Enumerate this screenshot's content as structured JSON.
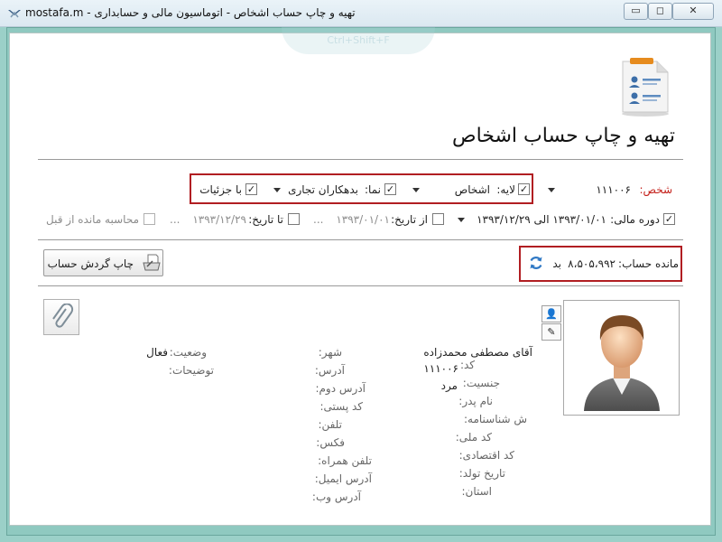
{
  "window": {
    "title": "mostafa.m - تهیه و چاپ حساب اشخاص - اتوماسیون مالی و حسابداری",
    "minimize_label": "▭",
    "maximize_label": "◻",
    "close_label": "✕"
  },
  "ghost_hint": "Ctrl+Shift+F",
  "page": {
    "title": "تهیه و چاپ حساب اشخاص"
  },
  "filters": {
    "person_label": "شخص:",
    "person_value": "۱۱۱۰۰۶",
    "layer_label": "لایه:",
    "layer_value": "اشخاص",
    "view_label": "نما:",
    "view_value": "بدهکاران تجاری",
    "details_label": "با جزئیات"
  },
  "period": {
    "fiscal_label": "دوره مالی:",
    "fiscal_value": "۱۳۹۳/۰۱/۰۱ الی ۱۳۹۳/۱۲/۲۹",
    "from_label": "از تاریخ:",
    "from_value": "۱۳۹۳/۰۱/۰۱",
    "to_label": "تا تاریخ:",
    "to_value": "۱۳۹۳/۱۲/۲۹",
    "ellipsis": "...",
    "prev_balance_label": "محاسبه مانده از قبل"
  },
  "balance": {
    "label": "مانده حساب:",
    "value": "۸،۵۰۵،۹۹۲",
    "type": "بد"
  },
  "actions": {
    "print_label": "چاپ گردش حساب"
  },
  "person": {
    "name": "آقای مصطفی محمدزاده",
    "code_label": "کد:",
    "code_value": "۱۱۱۰۰۶",
    "gender_label": "جنسیت:",
    "gender_value": "مرد",
    "father_label": "نام پدر:",
    "id_label": "ش شناسنامه:",
    "national_label": "کد ملی:",
    "economic_label": "کد اقتصادی:",
    "birth_label": "تاریخ تولد:",
    "province_label": "استان:",
    "city_label": "شهر:",
    "address_label": "آدرس:",
    "address2_label": "آدرس دوم:",
    "postal_label": "کد پستی:",
    "phone_label": "تلفن:",
    "fax_label": "فکس:",
    "mobile_label": "تلفن همراه:",
    "email_label": "آدرس ایمیل:",
    "web_label": "آدرس وب:",
    "status_label": "وضعیت:",
    "status_value": "فعال",
    "notes_label": "توضیحات:"
  },
  "side_buttons": {
    "person_glyph": "👤",
    "edit_glyph": "✎"
  },
  "icons": [
    "app-icon",
    "document-users-icon",
    "print-icon",
    "refresh-icon",
    "paperclip-icon",
    "person-avatar-icon",
    "pencil-icon"
  ],
  "colors": {
    "accent_red": "#b11e22",
    "frame_teal": "#8fc9c0",
    "label_red": "#c4211b"
  }
}
